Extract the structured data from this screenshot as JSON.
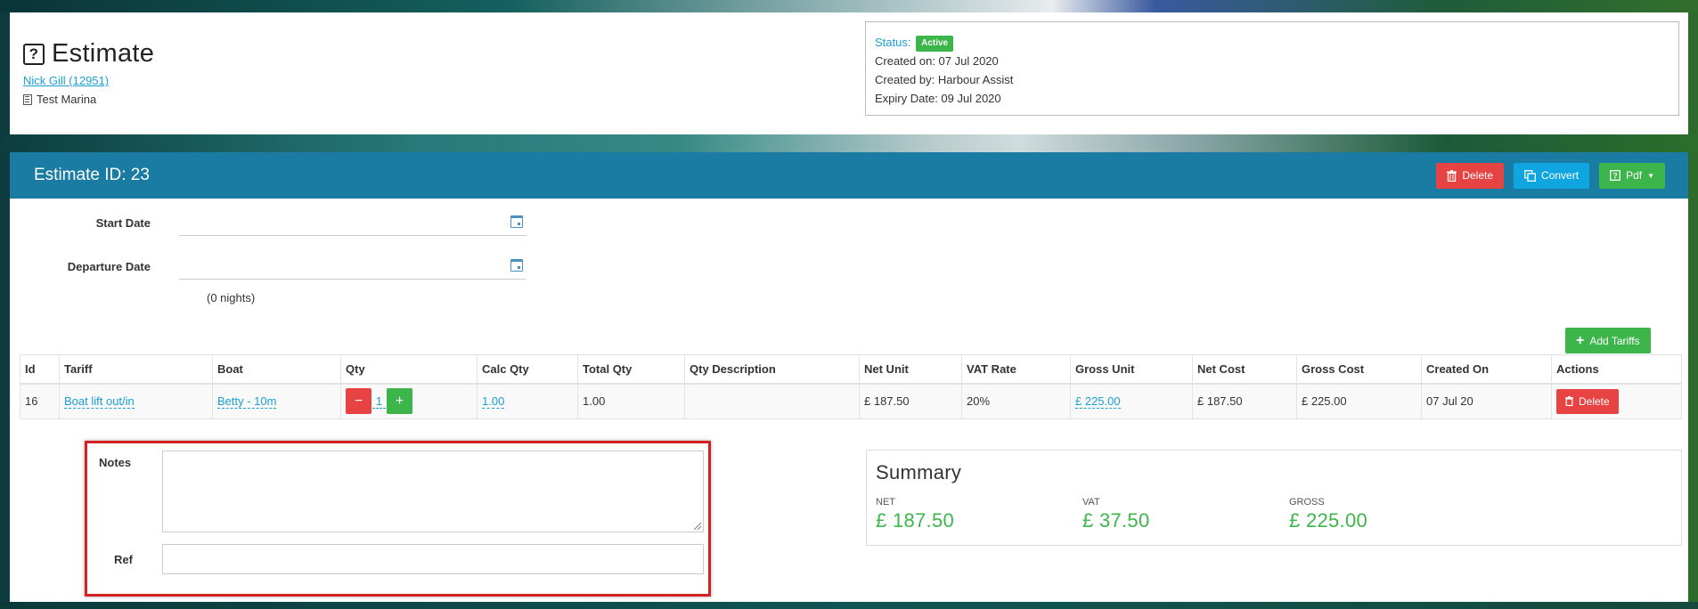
{
  "header": {
    "title": "Estimate",
    "customer_link": "Nick Gill (12951)",
    "marina": "Test Marina"
  },
  "status_box": {
    "status_label": "Status:",
    "status_value": "Active",
    "created_on": "Created on: 07 Jul 2020",
    "created_by": "Created by: Harbour Assist",
    "expiry_date": "Expiry Date: 09 Jul 2020"
  },
  "panel": {
    "title": "Estimate ID: 23",
    "buttons": {
      "delete": "Delete",
      "convert": "Convert",
      "pdf": "Pdf"
    }
  },
  "form": {
    "start_date_label": "Start Date",
    "start_date_value": "",
    "departure_date_label": "Departure Date",
    "departure_date_value": "",
    "nights": "(0 nights)"
  },
  "add_tariffs_label": "Add Tariffs",
  "table": {
    "columns": [
      "Id",
      "Tariff",
      "Boat",
      "Qty",
      "Calc Qty",
      "Total Qty",
      "Qty Description",
      "Net Unit",
      "VAT Rate",
      "Gross Unit",
      "Net Cost",
      "Gross Cost",
      "Created On",
      "Actions"
    ],
    "rows": [
      {
        "id": "16",
        "tariff": "Boat lift out/in",
        "boat": "Betty - 10m",
        "qty": "1",
        "calc_qty": "1.00",
        "total_qty": "1.00",
        "qty_description": "",
        "net_unit": "£ 187.50",
        "vat_rate": "20%",
        "gross_unit": "£ 225.00",
        "net_cost": "£ 187.50",
        "gross_cost": "£ 225.00",
        "created_on": "07 Jul 20",
        "action_delete": "Delete"
      }
    ]
  },
  "notes": {
    "notes_label": "Notes",
    "notes_value": "",
    "ref_label": "Ref",
    "ref_value": ""
  },
  "summary": {
    "title": "Summary",
    "net_label": "NET",
    "net_value": "£ 187.50",
    "vat_label": "VAT",
    "vat_value": "£ 37.50",
    "gross_label": "GROSS",
    "gross_value": "£ 225.00"
  },
  "colors": {
    "primary_blue": "#1a7ba3",
    "link_blue": "#1a9fd4",
    "danger_red": "#e84343",
    "success_green": "#3cb54a",
    "highlight_red": "#d42222"
  }
}
